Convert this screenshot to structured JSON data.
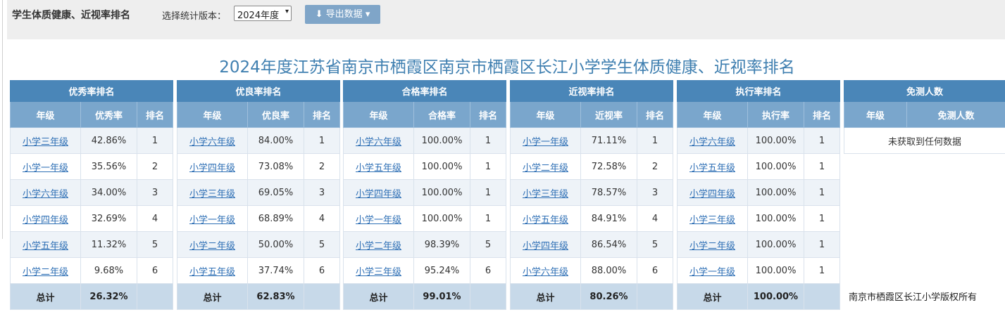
{
  "topbar": {
    "title": "学生体质健康、近视率排名",
    "version_label": "选择统计版本：",
    "version_selected": "2024年度",
    "export_label": "导出数据"
  },
  "page_title": "2024年度江苏省南京市栖霞区南京市栖霞区长江小学学生体质健康、近视率排名",
  "tables": [
    {
      "header": "优秀率排名",
      "cols": [
        "年级",
        "优秀率",
        "排名"
      ],
      "rows": [
        [
          "小学三年级",
          "42.86%",
          "1"
        ],
        [
          "小学一年级",
          "35.56%",
          "2"
        ],
        [
          "小学六年级",
          "34.00%",
          "3"
        ],
        [
          "小学四年级",
          "32.69%",
          "4"
        ],
        [
          "小学五年级",
          "11.32%",
          "5"
        ],
        [
          "小学二年级",
          "9.68%",
          "6"
        ]
      ],
      "total": [
        "总计",
        "26.32%",
        ""
      ]
    },
    {
      "header": "优良率排名",
      "cols": [
        "年级",
        "优良率",
        "排名"
      ],
      "rows": [
        [
          "小学六年级",
          "84.00%",
          "1"
        ],
        [
          "小学四年级",
          "73.08%",
          "2"
        ],
        [
          "小学三年级",
          "69.05%",
          "3"
        ],
        [
          "小学一年级",
          "68.89%",
          "4"
        ],
        [
          "小学二年级",
          "50.00%",
          "5"
        ],
        [
          "小学五年级",
          "37.74%",
          "6"
        ]
      ],
      "total": [
        "总计",
        "62.83%",
        ""
      ]
    },
    {
      "header": "合格率排名",
      "cols": [
        "年级",
        "合格率",
        "排名"
      ],
      "rows": [
        [
          "小学六年级",
          "100.00%",
          "1"
        ],
        [
          "小学五年级",
          "100.00%",
          "1"
        ],
        [
          "小学四年级",
          "100.00%",
          "1"
        ],
        [
          "小学一年级",
          "100.00%",
          "1"
        ],
        [
          "小学二年级",
          "98.39%",
          "5"
        ],
        [
          "小学三年级",
          "95.24%",
          "6"
        ]
      ],
      "total": [
        "总计",
        "99.01%",
        ""
      ]
    },
    {
      "header": "近视率排名",
      "cols": [
        "年级",
        "近视率",
        "排名"
      ],
      "rows": [
        [
          "小学一年级",
          "71.11%",
          "1"
        ],
        [
          "小学二年级",
          "72.58%",
          "2"
        ],
        [
          "小学三年级",
          "78.57%",
          "3"
        ],
        [
          "小学五年级",
          "84.91%",
          "4"
        ],
        [
          "小学四年级",
          "86.54%",
          "5"
        ],
        [
          "小学六年级",
          "88.00%",
          "6"
        ]
      ],
      "total": [
        "总计",
        "80.26%",
        ""
      ]
    },
    {
      "header": "执行率排名",
      "cols": [
        "年级",
        "执行率",
        "排名"
      ],
      "rows": [
        [
          "小学六年级",
          "100.00%",
          "1"
        ],
        [
          "小学五年级",
          "100.00%",
          "1"
        ],
        [
          "小学四年级",
          "100.00%",
          "1"
        ],
        [
          "小学三年级",
          "100.00%",
          "1"
        ],
        [
          "小学二年级",
          "100.00%",
          "1"
        ],
        [
          "小学一年级",
          "100.00%",
          "1"
        ]
      ],
      "total": [
        "总计",
        "100.00%",
        ""
      ]
    }
  ],
  "exempt_table": {
    "header": "免测人数",
    "cols": [
      "年级",
      "免测人数"
    ],
    "empty_text": "未获取到任何数据"
  },
  "copyright": "南京市栖霞区长江小学版权所有",
  "colors": {
    "header_dark": "#4a86b8",
    "header_light": "#7aa6cc",
    "total_row": "#c7d9e9",
    "link": "#2e6fb5",
    "title": "#3f7fb0"
  }
}
